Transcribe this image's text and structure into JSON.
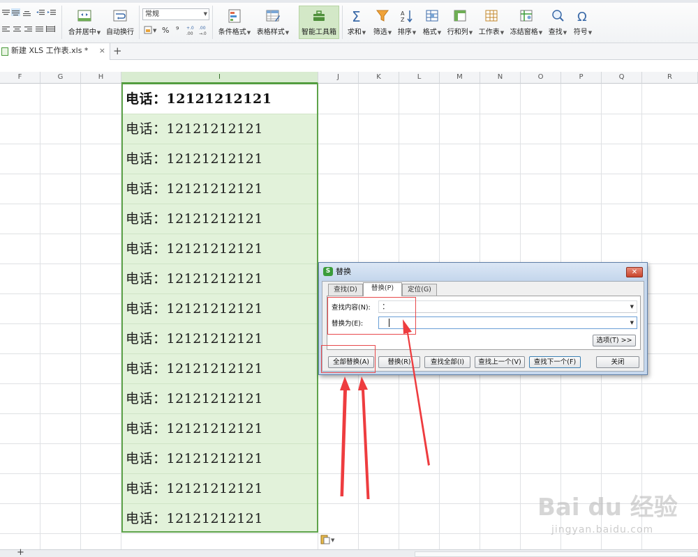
{
  "ribbon": {
    "merge_center": "合并居中",
    "auto_wrap": "自动换行",
    "number_format": "常规",
    "percent": "%",
    "comma": "⁹",
    "conditional_format": "条件格式",
    "table_style": "表格样式",
    "smart_toolbox": "智能工具箱",
    "sum": "求和",
    "filter": "筛选",
    "sort": "排序",
    "format": "格式",
    "row_col": "行和列",
    "worksheet": "工作表",
    "freeze": "冻结窗格",
    "find": "查找",
    "symbol": "符号"
  },
  "tabbar": {
    "doc_tab": "新建 XLS 工作表.xls *",
    "close": "×",
    "add": "+"
  },
  "columns": [
    "F",
    "G",
    "H",
    "I",
    "J",
    "K",
    "L",
    "M",
    "N",
    "O",
    "P",
    "Q",
    "R"
  ],
  "cells": {
    "rows": [
      "电话：12121212121",
      "电话：12121212121",
      "电话：12121212121",
      "电话：12121212121",
      "电话：12121212121",
      "电话：12121212121",
      "电话：12121212121",
      "电话：12121212121",
      "电话：12121212121",
      "电话：12121212121",
      "电话：12121212121",
      "电话：12121212121",
      "电话：12121212121",
      "电话：12121212121",
      "电话：12121212121"
    ]
  },
  "dialog": {
    "logo": "S",
    "title": "替换",
    "close": "✕",
    "tabs": [
      "查找(D)",
      "替换(P)",
      "定位(G)"
    ],
    "find_label": "查找内容(N):",
    "find_value": "：",
    "replace_label": "替换为(E):",
    "replace_value": "",
    "options_button": "选项(T) >>",
    "buttons": {
      "replace_all": "全部替换(A)",
      "replace": "替换(R)",
      "find_all": "查找全部(I)",
      "find_prev": "查找上一个(V)",
      "find_next": "查找下一个(F)",
      "close": "关闭"
    }
  },
  "watermark": {
    "brand": "Bai du 经验",
    "url": "jingyan.baidu.com"
  },
  "colors": {
    "accent": "#5ea34a",
    "selection_fill": "#e2f2da",
    "annotation": "#e8494b"
  }
}
